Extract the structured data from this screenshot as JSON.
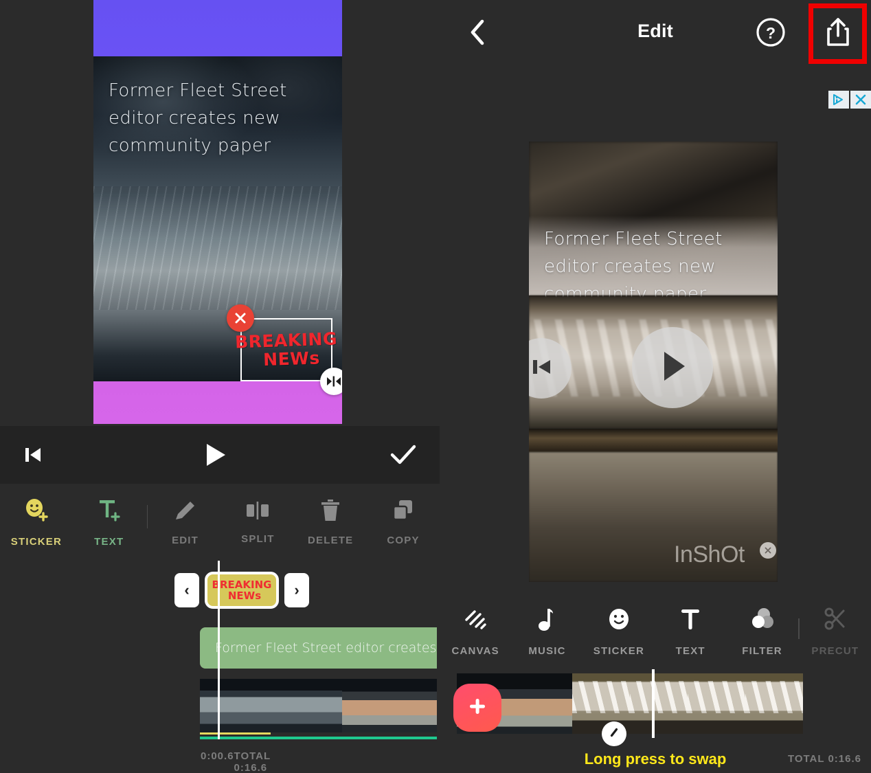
{
  "left": {
    "preview": {
      "caption": "Former Fleet Street\neditor creates new\ncommunity paper",
      "sticker": {
        "line1": "BREAKING",
        "line2": "NEWs"
      },
      "handles": {
        "delete": "delete-handle",
        "edit": "edit-handle",
        "flip": "flip-handle",
        "scale": "scale-handle"
      }
    },
    "playbar": {
      "prev_label": "skip-to-start",
      "play_label": "play",
      "confirm_label": "confirm"
    },
    "tools": [
      {
        "label": "STICKER",
        "icon": "sticker-add-icon",
        "state": "active"
      },
      {
        "label": "TEXT",
        "icon": "text-add-icon",
        "state": "active"
      },
      {
        "label": "EDIT",
        "icon": "pencil-icon",
        "state": "disabled"
      },
      {
        "label": "SPLIT",
        "icon": "split-icon",
        "state": "disabled"
      },
      {
        "label": "DELETE",
        "icon": "trash-icon",
        "state": "disabled"
      },
      {
        "label": "COPY",
        "icon": "copy-icon",
        "state": "disabled"
      }
    ],
    "timeline": {
      "prev_arrow": "‹",
      "next_arrow": "›",
      "sticker_chip": {
        "line1": "BREAKING",
        "line2": "NEWs"
      },
      "text_clip_label": "Former Fleet Street editor creates ne",
      "current_time": "0:00.6",
      "total_time": "TOTAL 0:16.6"
    }
  },
  "right": {
    "header": {
      "back_icon": "chevron-left-icon",
      "title": "Edit",
      "help_icon": "question-mark-icon",
      "share_icon": "share-icon",
      "highlight_color": "#f00000"
    },
    "ad": {
      "info_icon": "adchoices-icon",
      "close_icon": "close-icon"
    },
    "preview": {
      "caption": "Former Fleet Street\neditor creates new\ncommunity paper",
      "prev_icon": "skip-to-start-icon",
      "play_icon": "play-icon",
      "watermark": "InShOt",
      "watermark_close_icon": "close-icon"
    },
    "tools": [
      {
        "label": "CANVAS",
        "icon": "canvas-icon",
        "state": "enabled"
      },
      {
        "label": "MUSIC",
        "icon": "music-note-icon",
        "state": "enabled"
      },
      {
        "label": "STICKER",
        "icon": "smiley-icon",
        "state": "enabled"
      },
      {
        "label": "TEXT",
        "icon": "text-t-icon",
        "state": "enabled"
      },
      {
        "label": "FILTER",
        "icon": "filter-circles-icon",
        "state": "enabled"
      },
      {
        "label": "PRECUT",
        "icon": "scissors-icon",
        "state": "disabled"
      }
    ],
    "timeline": {
      "add_icon": "plus-icon",
      "split_icon": "split-marker-icon",
      "hint": "Long press to swap",
      "total_time": "TOTAL 0:16.6"
    }
  }
}
